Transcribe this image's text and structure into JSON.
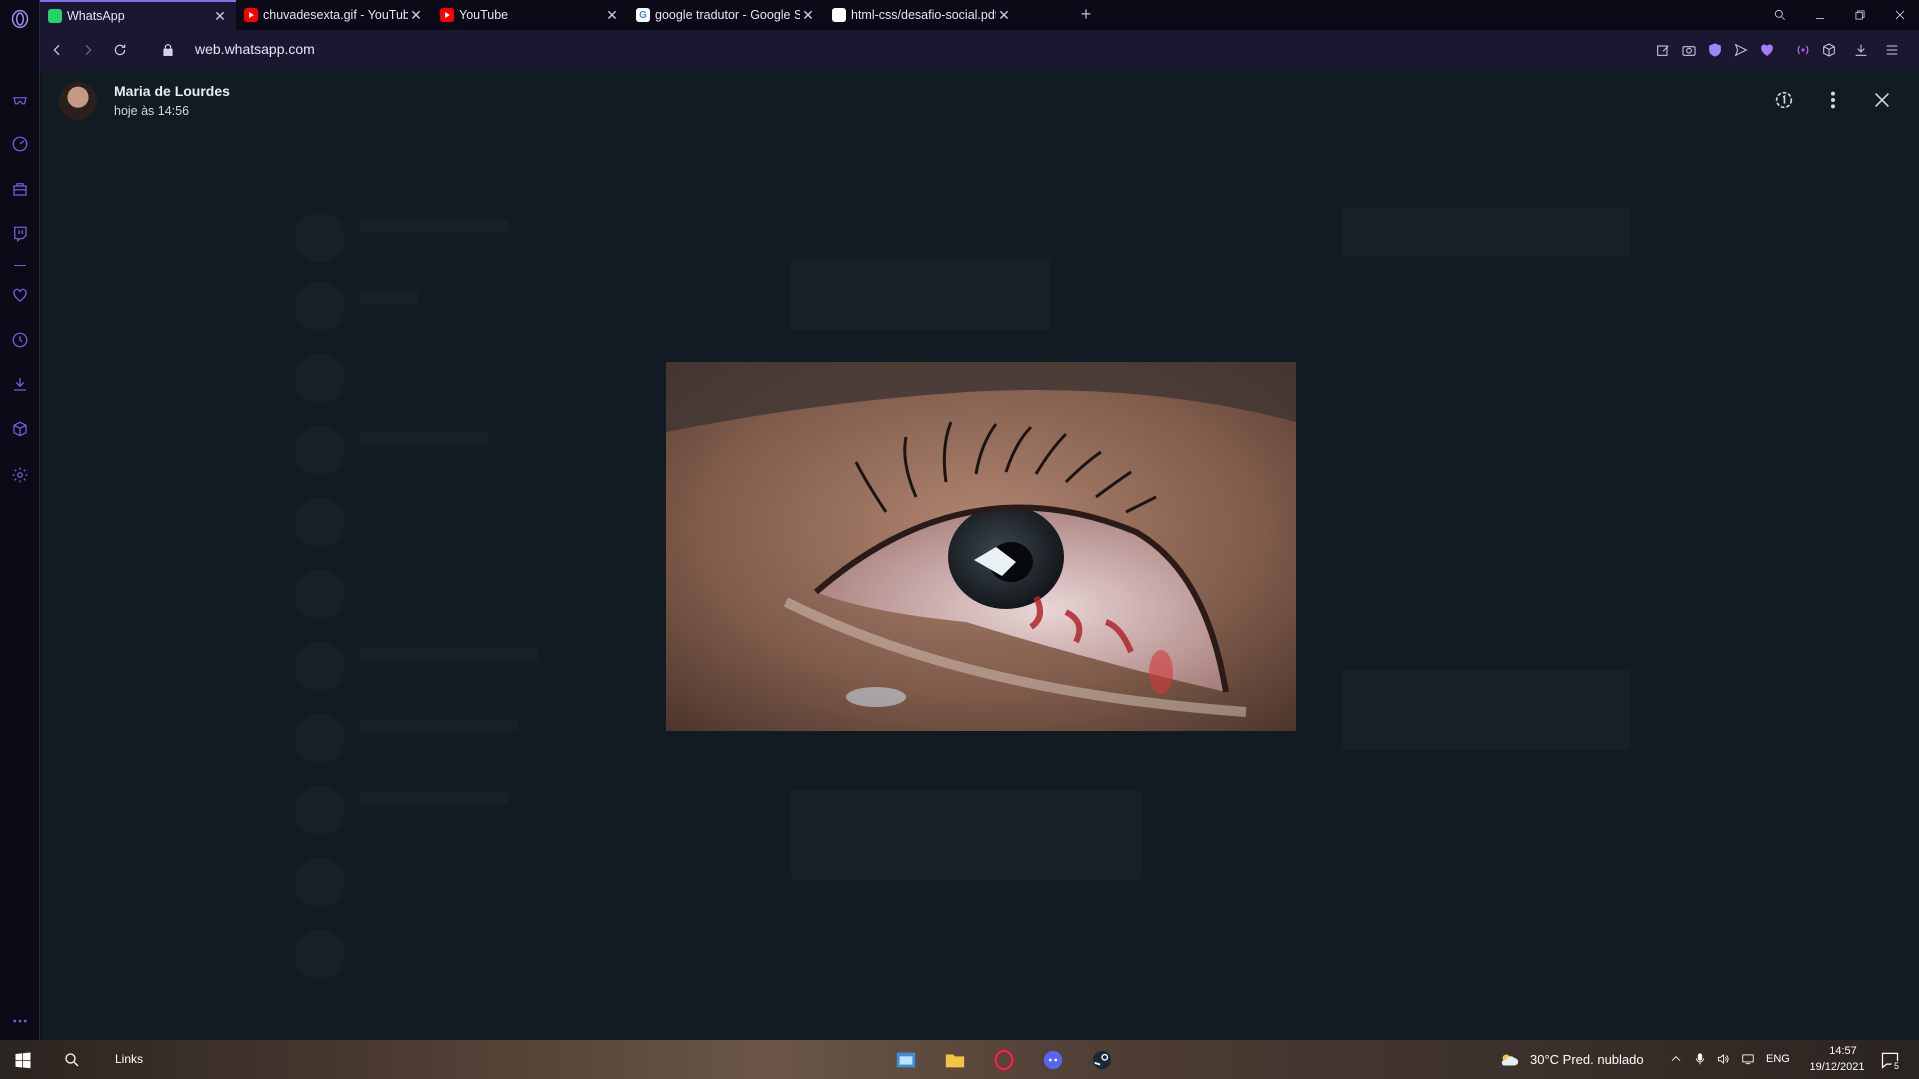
{
  "tabs": [
    {
      "title": "WhatsApp",
      "icon": "whatsapp-icon",
      "active": true
    },
    {
      "title": "chuvadesexta.gif - YouTube",
      "icon": "youtube-icon"
    },
    {
      "title": "YouTube",
      "icon": "youtube-icon"
    },
    {
      "title": "google tradutor - Google S",
      "icon": "google-icon"
    },
    {
      "title": "html-css/desafio-social.pdf",
      "icon": "github-icon"
    }
  ],
  "address_bar": {
    "url": "web.whatsapp.com"
  },
  "viewer": {
    "contact_name": "Maria de Lourdes",
    "timestamp": "hoje às 14:56"
  },
  "taskbar": {
    "links_label": "Links",
    "weather": "30°C  Pred. nublado",
    "language": "ENG",
    "time": "14:57",
    "date": "19/12/2021",
    "notification_count": "5"
  }
}
